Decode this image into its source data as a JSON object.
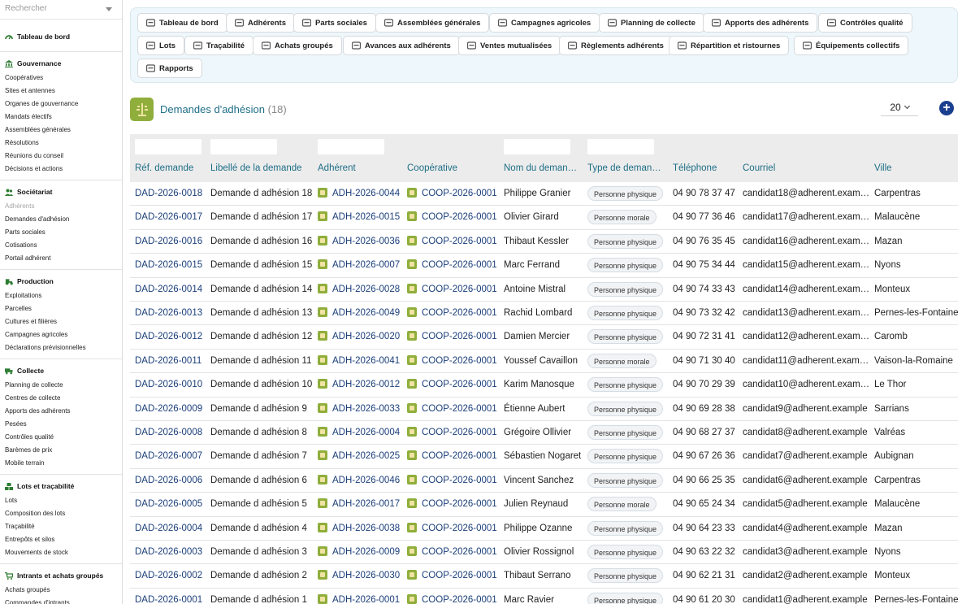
{
  "sidebar": {
    "search_placeholder": "Rechercher",
    "dashboard": "Tableau de bord",
    "sections": [
      {
        "title": "Gouvernance",
        "icon": "bank-icon",
        "items": [
          "Coopératives",
          "Sites et antennes",
          "Organes de gouvernance",
          "Mandats électifs",
          "Assemblées générales",
          "Résolutions",
          "Réunions du conseil",
          "Décisions et actions"
        ]
      },
      {
        "title": "Sociétariat",
        "icon": "users-icon",
        "items": [
          "Adhérents",
          "Demandes d'adhésion",
          "Parts sociales",
          "Cotisations",
          "Portail adhérent"
        ]
      },
      {
        "title": "Production",
        "icon": "tractor-icon",
        "items": [
          "Exploitations",
          "Parcelles",
          "Cultures et filières",
          "Campagnes agricoles",
          "Déclarations prévisionnelles"
        ]
      },
      {
        "title": "Collecte",
        "icon": "truck-icon",
        "items": [
          "Planning de collecte",
          "Centres de collecte",
          "Apports des adhérents",
          "Pesées",
          "Contrôles qualité",
          "Barèmes de prix",
          "Mobile terrain"
        ]
      },
      {
        "title": "Lots et traçabilité",
        "icon": "boxes-icon",
        "items": [
          "Lots",
          "Composition des lots",
          "Traçabilité",
          "Entrepôts et silos",
          "Mouvements de stock"
        ]
      },
      {
        "title": "Intrants et achats groupés",
        "icon": "cart-icon",
        "items": [
          "Achats groupés",
          "Commandes d'intrants"
        ]
      }
    ]
  },
  "nav_chips": [
    "Tableau de bord",
    "Adhérents",
    "Parts sociales",
    "Assemblées générales",
    "Campagnes agricoles",
    "Planning de collecte",
    "Apports des adhérents",
    "Contrôles qualité",
    "Lots",
    "Traçabilité",
    "Achats groupés",
    "Avances aux adhérents",
    "Ventes mutualisées",
    "Règlements adhérents",
    "Répartition et ristournes",
    "Équipements collectifs",
    "Rapports"
  ],
  "header": {
    "title": "Demandes d'adhésion",
    "count": "(18)",
    "per_page": "20",
    "add_label": "+"
  },
  "table": {
    "columns": [
      "Réf. demande",
      "Libellé de la demande",
      "Adhérent",
      "Coopérative",
      "Nom du deman…",
      "Type de deman…",
      "Téléphone",
      "Courriel",
      "Ville"
    ],
    "rows": [
      [
        "DAD-2026-0018",
        "Demande d adhésion 18",
        "ADH-2026-0044",
        "COOP-2026-0001",
        "Philippe Granier",
        "Personne physique",
        "04 90 78 37 47",
        "candidat18@adherent.exam…",
        "Carpentras"
      ],
      [
        "DAD-2026-0017",
        "Demande d adhésion 17",
        "ADH-2026-0015",
        "COOP-2026-0001",
        "Olivier Girard",
        "Personne morale",
        "04 90 77 36 46",
        "candidat17@adherent.exam…",
        "Malaucène"
      ],
      [
        "DAD-2026-0016",
        "Demande d adhésion 16",
        "ADH-2026-0036",
        "COOP-2026-0001",
        "Thibaut Kessler",
        "Personne physique",
        "04 90 76 35 45",
        "candidat16@adherent.exam…",
        "Mazan"
      ],
      [
        "DAD-2026-0015",
        "Demande d adhésion 15",
        "ADH-2026-0007",
        "COOP-2026-0001",
        "Marc Ferrand",
        "Personne physique",
        "04 90 75 34 44",
        "candidat15@adherent.exam…",
        "Nyons"
      ],
      [
        "DAD-2026-0014",
        "Demande d adhésion 14",
        "ADH-2026-0028",
        "COOP-2026-0001",
        "Antoine Mistral",
        "Personne physique",
        "04 90 74 33 43",
        "candidat14@adherent.exam…",
        "Monteux"
      ],
      [
        "DAD-2026-0013",
        "Demande d adhésion 13",
        "ADH-2026-0049",
        "COOP-2026-0001",
        "Rachid Lombard",
        "Personne physique",
        "04 90 73 32 42",
        "candidat13@adherent.exam…",
        "Pernes-les-Fontaines"
      ],
      [
        "DAD-2026-0012",
        "Demande d adhésion 12",
        "ADH-2026-0020",
        "COOP-2026-0001",
        "Damien Mercier",
        "Personne physique",
        "04 90 72 31 41",
        "candidat12@adherent.exam…",
        "Caromb"
      ],
      [
        "DAD-2026-0011",
        "Demande d adhésion 11",
        "ADH-2026-0041",
        "COOP-2026-0001",
        "Youssef Cavaillon",
        "Personne morale",
        "04 90 71 30 40",
        "candidat11@adherent.exam…",
        "Vaison-la-Romaine"
      ],
      [
        "DAD-2026-0010",
        "Demande d adhésion 10",
        "ADH-2026-0012",
        "COOP-2026-0001",
        "Karim Manosque",
        "Personne physique",
        "04 90 70 29 39",
        "candidat10@adherent.exam…",
        "Le Thor"
      ],
      [
        "DAD-2026-0009",
        "Demande d adhésion 9",
        "ADH-2026-0033",
        "COOP-2026-0001",
        "Étienne Aubert",
        "Personne physique",
        "04 90 69 28 38",
        "candidat9@adherent.example",
        "Sarrians"
      ],
      [
        "DAD-2026-0008",
        "Demande d adhésion 8",
        "ADH-2026-0004",
        "COOP-2026-0001",
        "Grégoire Ollivier",
        "Personne physique",
        "04 90 68 27 37",
        "candidat8@adherent.example",
        "Valréas"
      ],
      [
        "DAD-2026-0007",
        "Demande d adhésion 7",
        "ADH-2026-0025",
        "COOP-2026-0001",
        "Sébastien Nogaret",
        "Personne physique",
        "04 90 67 26 36",
        "candidat7@adherent.example",
        "Aubignan"
      ],
      [
        "DAD-2026-0006",
        "Demande d adhésion 6",
        "ADH-2026-0046",
        "COOP-2026-0001",
        "Vincent Sanchez",
        "Personne physique",
        "04 90 66 25 35",
        "candidat6@adherent.example",
        "Carpentras"
      ],
      [
        "DAD-2026-0005",
        "Demande d adhésion 5",
        "ADH-2026-0017",
        "COOP-2026-0001",
        "Julien Reynaud",
        "Personne morale",
        "04 90 65 24 34",
        "candidat5@adherent.example",
        "Malaucène"
      ],
      [
        "DAD-2026-0004",
        "Demande d adhésion 4",
        "ADH-2026-0038",
        "COOP-2026-0001",
        "Philippe Ozanne",
        "Personne physique",
        "04 90 64 23 33",
        "candidat4@adherent.example",
        "Mazan"
      ],
      [
        "DAD-2026-0003",
        "Demande d adhésion 3",
        "ADH-2026-0009",
        "COOP-2026-0001",
        "Olivier Rossignol",
        "Personne physique",
        "04 90 63 22 32",
        "candidat3@adherent.example",
        "Nyons"
      ],
      [
        "DAD-2026-0002",
        "Demande d adhésion 2",
        "ADH-2026-0030",
        "COOP-2026-0001",
        "Thibaut Serrano",
        "Personne physique",
        "04 90 62 21 31",
        "candidat2@adherent.example",
        "Monteux"
      ],
      [
        "DAD-2026-0001",
        "Demande d adhésion 1",
        "ADH-2026-0001",
        "COOP-2026-0001",
        "Marc Ravier",
        "Personne physique",
        "04 90 61 20 30",
        "candidat1@adherent.example",
        "Pernes-les-Fontaines"
      ]
    ]
  },
  "colors": {
    "link": "#1a3e7a",
    "header_text": "#1e6e86",
    "nav_bg": "#eef7fb",
    "accent_green": "#8fae3c",
    "add_button": "#1a3f8f"
  }
}
